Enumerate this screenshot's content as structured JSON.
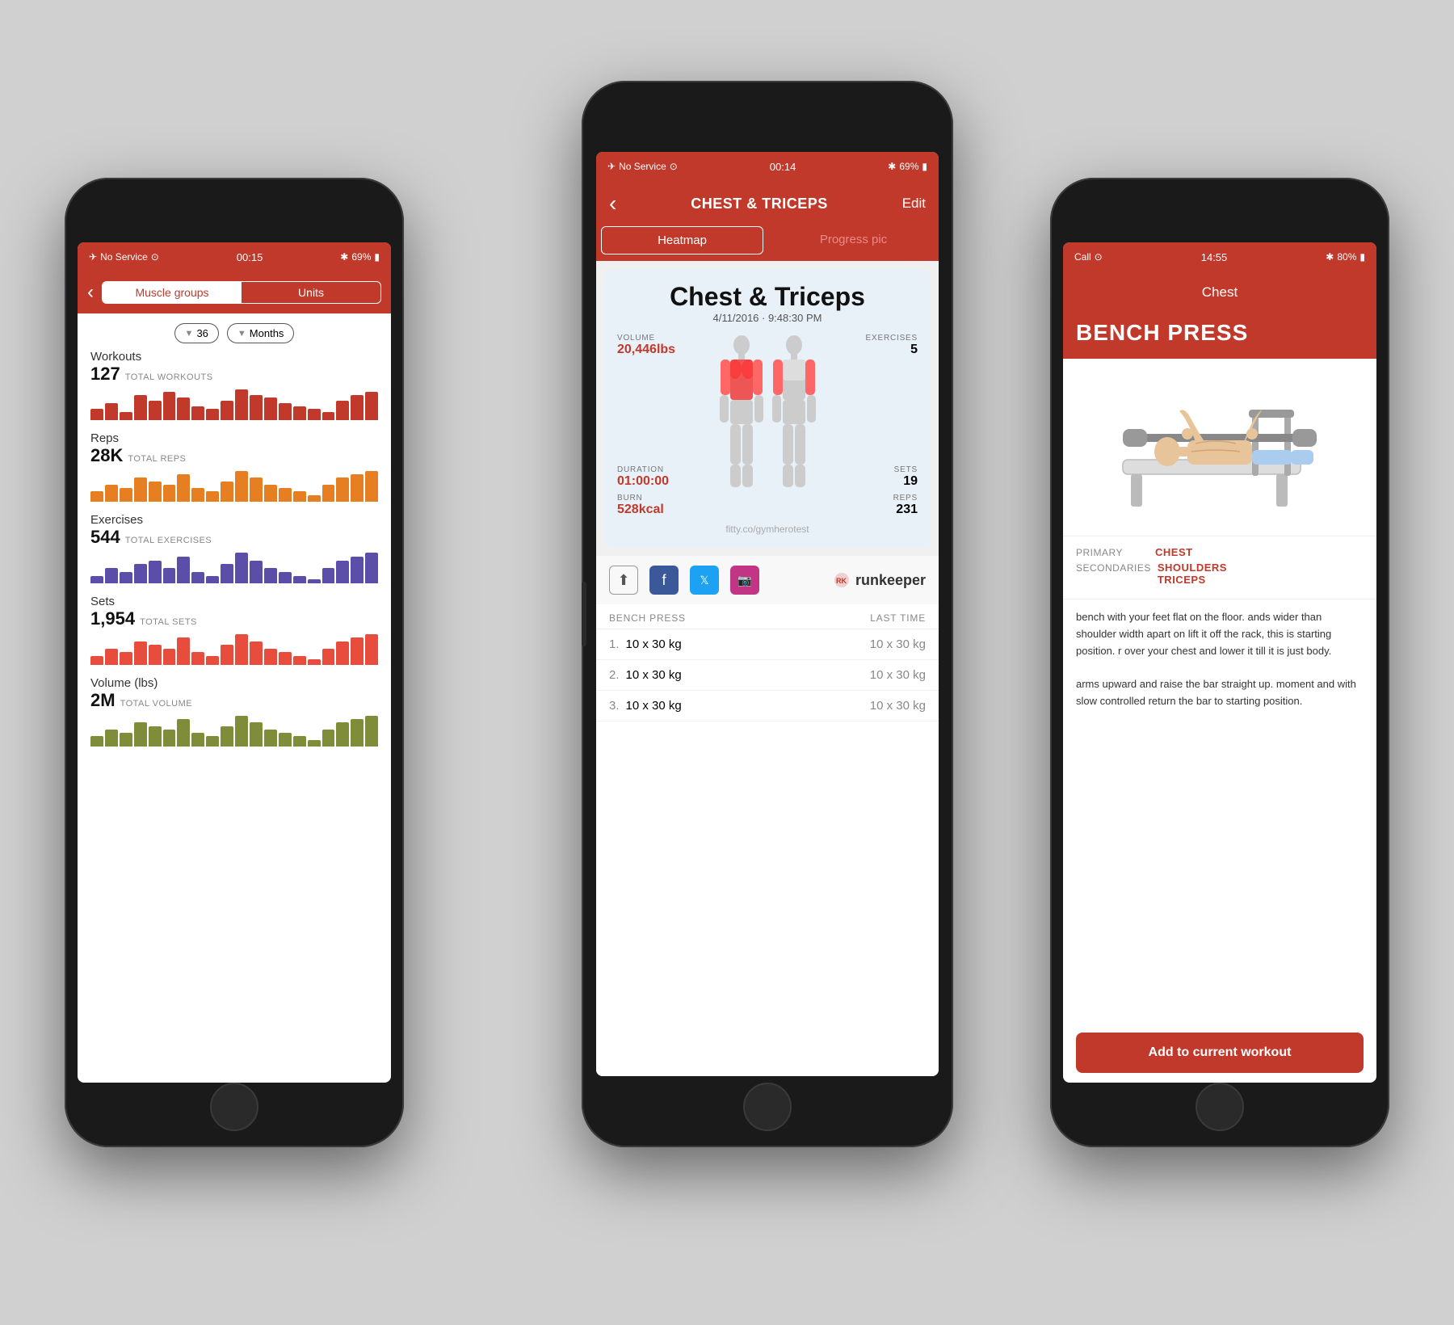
{
  "colors": {
    "primary": "#c0392b",
    "dark": "#1a1a1a",
    "text": "#111",
    "muted": "#888",
    "bg": "#d0d0d0"
  },
  "phone_left": {
    "status": {
      "carrier": "No Service",
      "wifi": true,
      "time": "00:15",
      "bluetooth": true,
      "battery": "69%"
    },
    "nav": {
      "back": "‹",
      "seg_left": "Muscle groups",
      "seg_right": "Units"
    },
    "filter": {
      "number": "36",
      "period": "Months"
    },
    "sections": [
      {
        "label": "Workouts",
        "value": "127",
        "sublabel": "TOTAL WORKOUTS",
        "color": "#c0392b",
        "bars": [
          8,
          12,
          6,
          18,
          14,
          20,
          16,
          10,
          8,
          14,
          22,
          18,
          16,
          12,
          10,
          8,
          6,
          14,
          18,
          20
        ]
      },
      {
        "label": "Reps",
        "value": "28K",
        "sublabel": "TOTAL REPS",
        "color": "#e67e22",
        "bars": [
          6,
          10,
          8,
          14,
          12,
          10,
          16,
          8,
          6,
          12,
          18,
          14,
          10,
          8,
          6,
          4,
          10,
          14,
          16,
          18
        ]
      },
      {
        "label": "Exercises",
        "value": "544",
        "sublabel": "TOTAL EXERCISES",
        "color": "#5b4ea8",
        "bars": [
          4,
          8,
          6,
          10,
          12,
          8,
          14,
          6,
          4,
          10,
          16,
          12,
          8,
          6,
          4,
          2,
          8,
          12,
          14,
          16
        ]
      },
      {
        "label": "Sets",
        "value": "1,954",
        "sublabel": "TOTAL SETS",
        "color": "#e74c3c",
        "bars": [
          5,
          9,
          7,
          13,
          11,
          9,
          15,
          7,
          5,
          11,
          17,
          13,
          9,
          7,
          5,
          3,
          9,
          13,
          15,
          17
        ]
      },
      {
        "label": "Volume (lbs)",
        "value": "2M",
        "sublabel": "TOTAL VOLUME",
        "color": "#7f8c3a",
        "bars": [
          6,
          10,
          8,
          14,
          12,
          10,
          16,
          8,
          6,
          12,
          18,
          14,
          10,
          8,
          6,
          4,
          10,
          14,
          16,
          18
        ]
      }
    ]
  },
  "phone_center": {
    "status": {
      "carrier": "No Service",
      "wifi": true,
      "time": "00:14",
      "bluetooth": true,
      "battery": "69%"
    },
    "nav": {
      "back": "‹",
      "title": "CHEST & TRICEPS",
      "edit": "Edit"
    },
    "tabs": {
      "heatmap": "Heatmap",
      "progress": "Progress pic"
    },
    "workout": {
      "title": "Chest & Triceps",
      "date": "4/11/2016 · 9:48:30 PM",
      "volume_label": "VOLUME",
      "volume_value": "20,446lbs",
      "exercises_label": "EXERCISES",
      "exercises_value": "5",
      "duration_label": "DURATION",
      "duration_value": "01:00:00",
      "sets_label": "SETS",
      "sets_value": "19",
      "burn_label": "BURN",
      "burn_value": "528kcal",
      "reps_label": "REPS",
      "reps_value": "231",
      "watermark": "fitty.co/gymherotest"
    },
    "exercise_list": {
      "name": "BENCH PRESS",
      "last_time_label": "LAST TIME",
      "rows": [
        {
          "num": "1.",
          "val": "10 x 30 kg",
          "last": "10 x 30 kg"
        },
        {
          "num": "2.",
          "val": "10 x 30 kg",
          "last": "10 x 30 kg"
        },
        {
          "num": "3.",
          "val": "10 x 30 kg",
          "last": "10 x 30 kg"
        }
      ]
    }
  },
  "phone_right": {
    "status": {
      "carrier": "Call",
      "wifi": true,
      "time": "14:55",
      "bluetooth": true,
      "battery": "80%"
    },
    "nav": {
      "title": "Chest"
    },
    "exercise": {
      "name": "BENCH PRESS",
      "primary_label": "PRIMARY",
      "primary_value": "CHEST",
      "secondary_label": "SECONDARIES",
      "secondary_value": "SHOULDERS\nTRICEPS",
      "description": "bench with your feet flat on the floor. ands wider than shoulder width apart on lift it off the rack, this is starting position. r over your chest and lower it till it is just body.\n\narms upward and raise the bar straight up. moment and with slow controlled return the bar to starting position.",
      "button": "Add to current workout"
    }
  }
}
